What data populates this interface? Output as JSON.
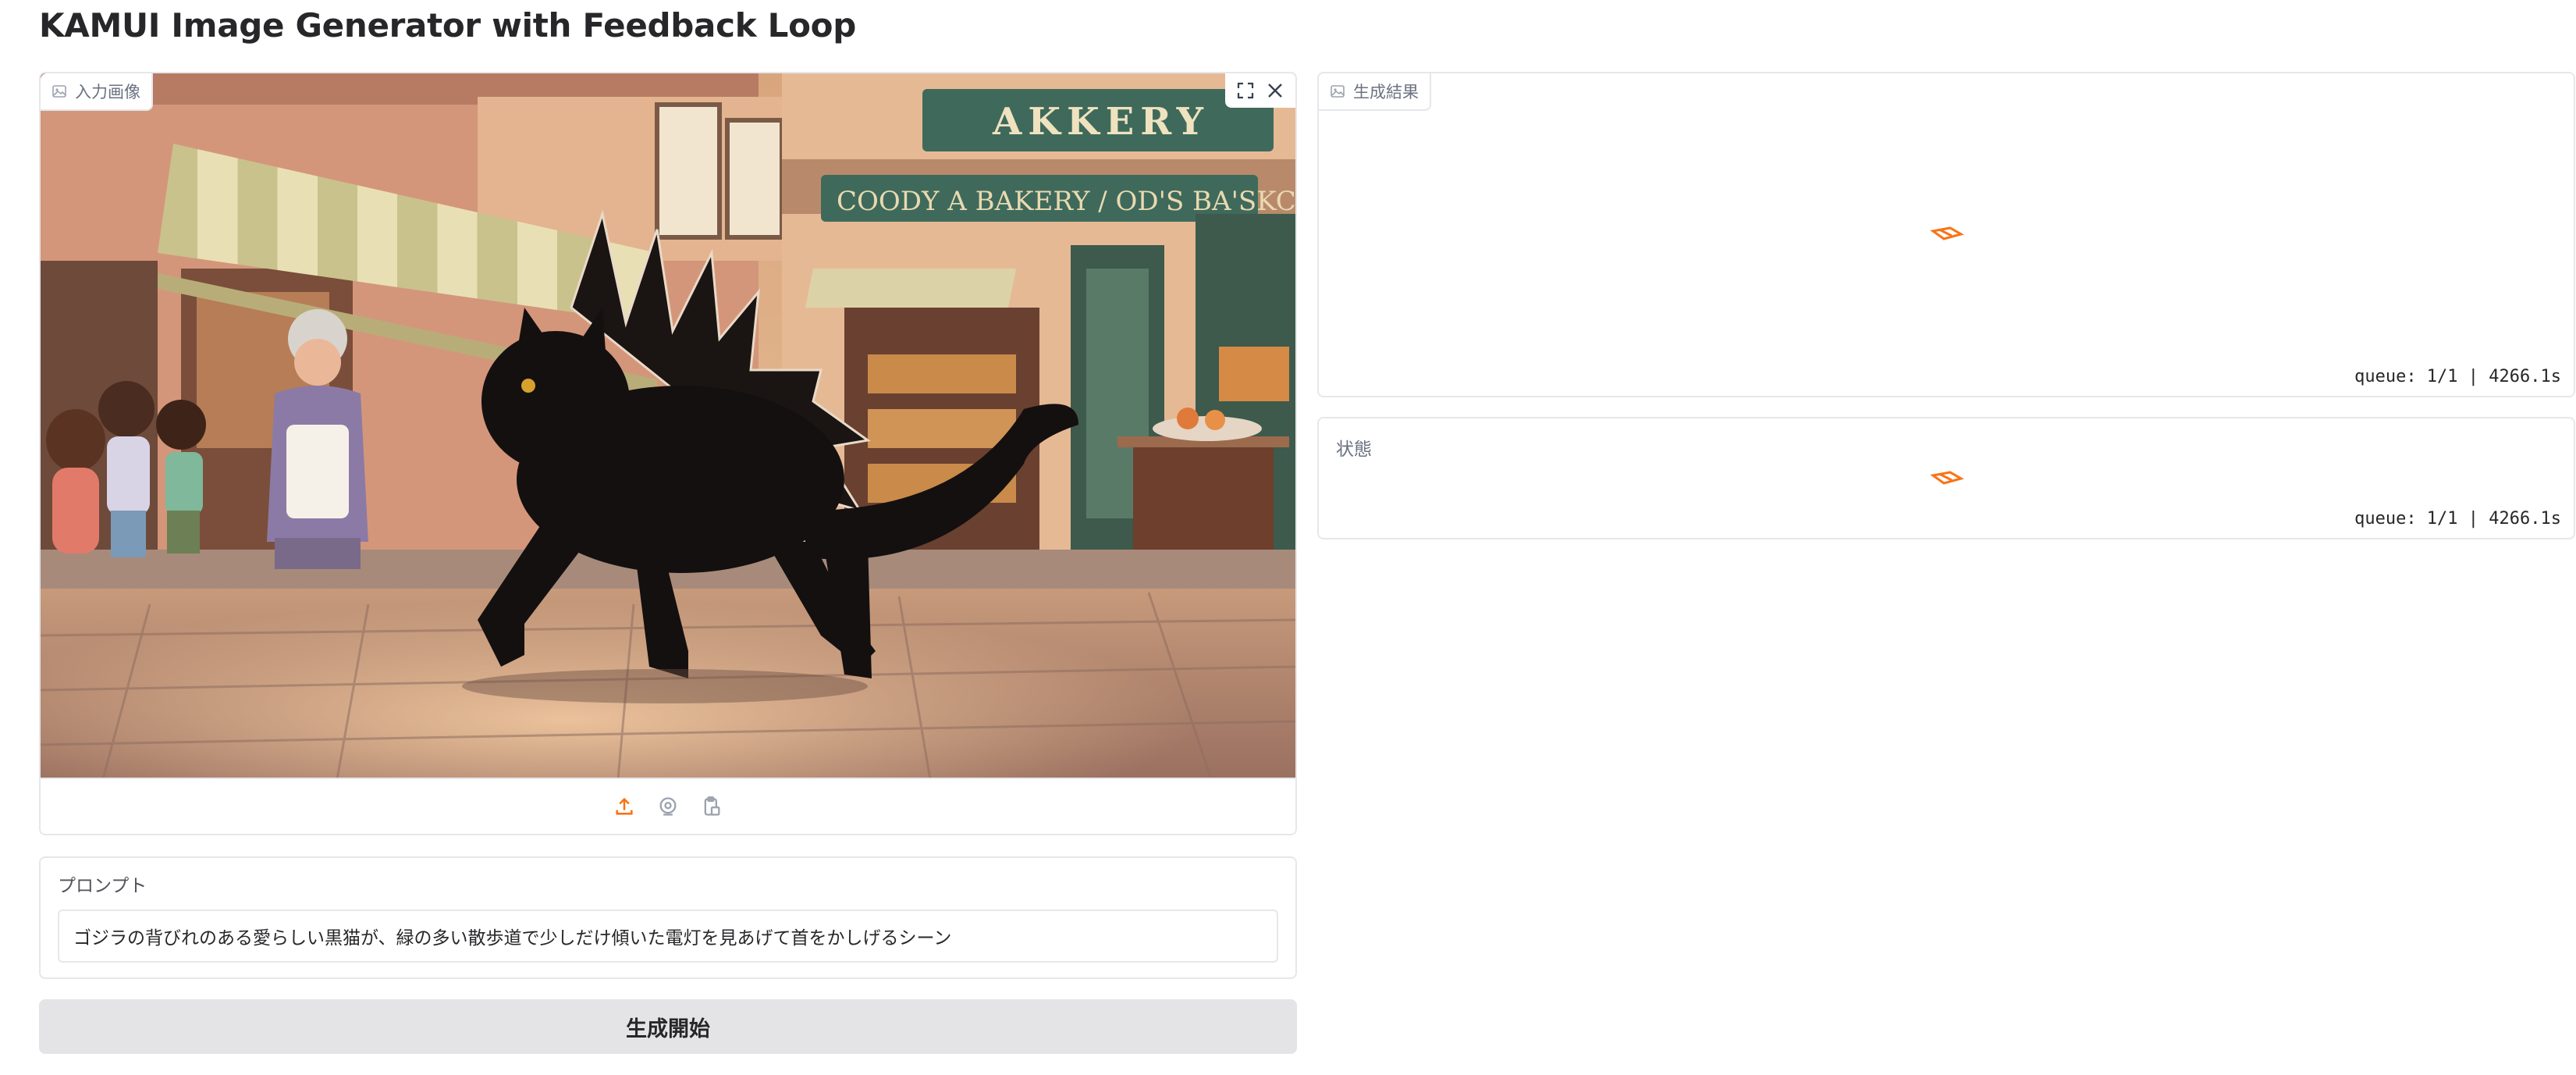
{
  "app": {
    "title": "KAMUI Image Generator with Feedback Loop"
  },
  "input_image": {
    "label": "入力画像",
    "label_icon": "image-icon",
    "controls": {
      "fullscreen_icon": "fullscreen-icon",
      "clear_icon": "close-icon"
    },
    "sources": [
      "upload-icon",
      "webcam-icon",
      "clipboard-icon"
    ],
    "image_signs": {
      "top_sign": "AKKERY",
      "front_sign": "COODY A BAKERY / OD'S BA'SKC RBY"
    }
  },
  "prompt": {
    "label": "プロンプト",
    "value": "ゴジラの背びれのある愛らしい黒猫が、緑の多い散歩道で少しだけ傾いた電灯を見あげて首をかしげるシーン"
  },
  "generate_button": {
    "label": "生成開始"
  },
  "result": {
    "label": "生成結果",
    "label_icon": "image-icon",
    "queue": "queue: 1/1 | 4266.1s"
  },
  "status": {
    "label": "状態",
    "queue": "queue: 1/1 | 4266.1s"
  },
  "colors": {
    "accent": "#f97316",
    "border": "#e5e7eb",
    "button_bg": "#e4e4e7"
  }
}
